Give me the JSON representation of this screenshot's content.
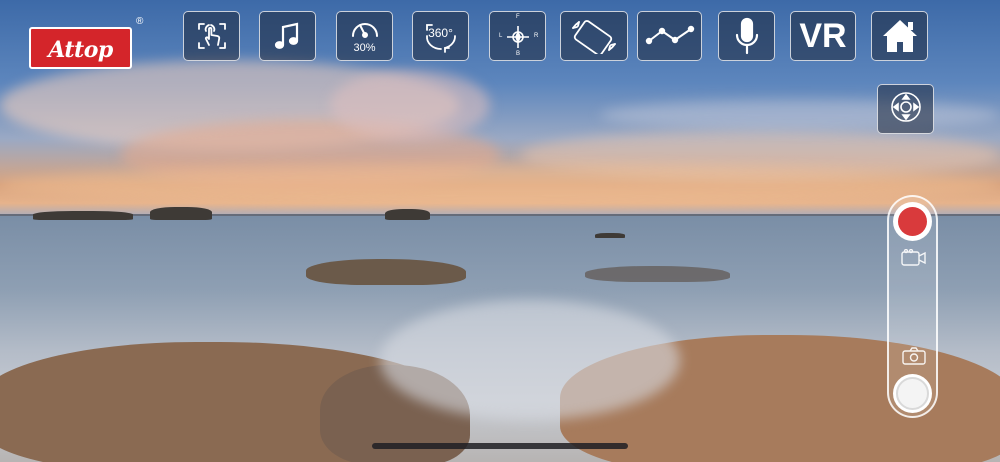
{
  "brand": {
    "logo_text": "Attop",
    "registered_mark": "®"
  },
  "toolbar": {
    "speed_percent": "30%",
    "rotate_label": "360°",
    "compass_letters": {
      "north": "F",
      "west": "L",
      "east": "R",
      "south": "B"
    },
    "vr_label": "VR",
    "buttons": [
      {
        "icon": "gesture-hand-icon"
      },
      {
        "icon": "music-note-icon"
      },
      {
        "icon": "speed-gauge-icon"
      },
      {
        "icon": "rotate-360-icon"
      },
      {
        "icon": "compass-calibrate-icon"
      },
      {
        "icon": "gravity-tilt-icon"
      },
      {
        "icon": "trajectory-path-icon"
      },
      {
        "icon": "microphone-icon"
      },
      {
        "icon": "vr-icon"
      },
      {
        "icon": "home-icon"
      }
    ]
  },
  "controls": {
    "gyro_icon": "dpad-control-icon",
    "record_color": "#d93a3c",
    "video_icon": "video-camera-icon",
    "photo_icon": "photo-camera-icon"
  }
}
